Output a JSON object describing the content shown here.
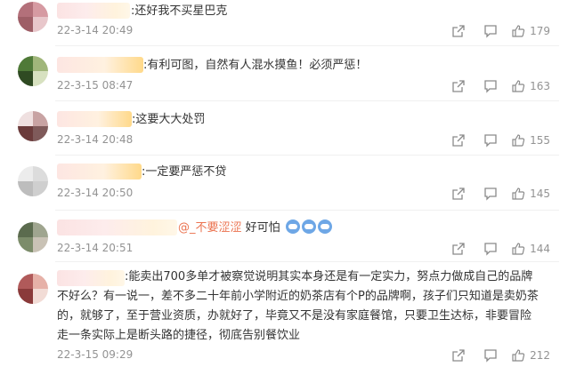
{
  "comments": [
    {
      "text": ":还好我不买星巴克",
      "time": "22-3-14 20:49",
      "likes": "179",
      "avatar_colors": [
        "#b3707a",
        "#d69aa2",
        "#9e5e66",
        "#e8c7cb"
      ]
    },
    {
      "text": ":有利可图，自然有人混水摸鱼！必须严惩！",
      "time": "22-3-15 08:47",
      "likes": "163",
      "avatar_colors": [
        "#4f7a38",
        "#a0b67a",
        "#2f4a22",
        "#d7e1c0"
      ]
    },
    {
      "text": ":这要大大处罚",
      "time": "22-3-14 20:48",
      "likes": "155",
      "avatar_colors": [
        "#7f5a5a",
        "#c8a3a3",
        "#6b3b3b",
        "#efe0e0"
      ]
    },
    {
      "text": ":一定要严惩不贷",
      "time": "22-3-14 20:50",
      "likes": "145",
      "avatar_colors": [
        "#dcdcdc",
        "#bdbdbd",
        "#ececec",
        "#cfcfcf"
      ]
    },
    {
      "mention": "@_不要涩涩",
      "text": " 好可怕",
      "emoji_count": 3,
      "time": "22-3-14 20:51",
      "likes": "144",
      "avatar_colors": [
        "#5b6b4e",
        "#9fa58f",
        "#7c8c6a",
        "#c9c2b5"
      ]
    },
    {
      "text": ":能卖出700多单才被察觉说明其实本身还是有一定实力，努点力做成自己的品牌不好么？有一说一，差不多二十年前小学附近的奶茶店有个P的品牌啊，孩子们只知道是卖奶茶的，就够了，至于营业资质，办就好了，毕竟又不是没有家庭餐馆，只要卫生达标，非要冒险走一条实际上是断头路的捷径，彻底告别餐饮业",
      "time": "22-3-15 09:29",
      "likes": "212",
      "avatar_colors": [
        "#b05a5a",
        "#e6b1a8",
        "#8a3a3a",
        "#f2dcd6"
      ]
    }
  ],
  "icons": {
    "forward": "share-icon",
    "reply": "comment-icon",
    "like": "thumbs-up-icon"
  }
}
